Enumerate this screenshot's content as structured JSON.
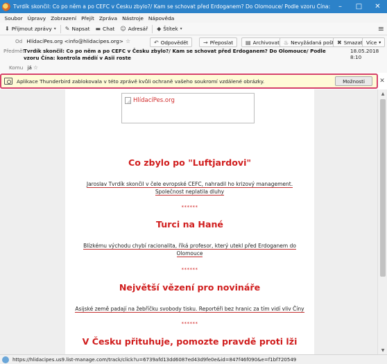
{
  "window": {
    "title": "Tvrdík skončil: Co po něm a po CEFC v Česku zbylo?/ Kam se schovat před Erdoganem? Do Olomouce/ Podle vzoru Čína: kontrola médií v Asii r..."
  },
  "menu": [
    "Soubor",
    "Úpravy",
    "Zobrazení",
    "Přejít",
    "Zpráva",
    "Nástroje",
    "Nápověda"
  ],
  "toolbar": {
    "receive": "Přijmout zprávy",
    "write": "Napsat",
    "chat": "Chat",
    "addressbook": "Adresář",
    "tag": "Štítek"
  },
  "header": {
    "from_label": "Od",
    "from_value": "HlídacíPes.org <info@hlidacipes.org>",
    "subject_label": "Předmět",
    "subject_value": "Tvrdík skončil: Co po něm a po CEFC v Česku zbylo?/ Kam se schovat před Erdoganem? Do Olomouce/ Podle vzoru Čína: kontrola médií v Asii roste",
    "to_label": "Komu",
    "to_value": "já",
    "date": "18.05.2018 8:10",
    "buttons": {
      "reply": "Odpovědět",
      "forward": "Přeposlat",
      "archive": "Archivovat",
      "junk": "Nevyžádaná pošta",
      "delete": "Smazat",
      "more": "Více"
    }
  },
  "notification": {
    "text": "Aplikace Thunderbird zablokovala v této zprávě kvůli ochraně vašeho soukromí vzdálené obrázky.",
    "options": "Možnosti"
  },
  "body": {
    "image_alt": "HlídacíPes.org",
    "section1_title": "Co zbylo po \"Luftjardovi\"",
    "section1_line1": "Jaroslav Tvrdík skončil v čele evropské CEFC, nahradil ho krizový management.",
    "section1_line2": "Společnost neplatila dluhy",
    "section2_title": "Turci na Hané",
    "section2_line1": "Blízkému východu chybí racionalita, říká profesor, který utekl před Erdoganem do",
    "section2_line2": "Olomouce",
    "section3_title": "Největší vězení pro novináře",
    "section3_line1": "Asijské země padají na žebříčku svobody tisku. Reportéři bez hranic za tím vidí vliv Číny",
    "section4_title": "V Česku přituhuje, pomozte pravdě proti lži",
    "separator": "******"
  },
  "status": {
    "url": "https://hlidacipes.us9.list-manage.com/track/click?u=6739afd13dd6087ed43d9fe0e&id=847f46f090&e=f1bf720549"
  }
}
